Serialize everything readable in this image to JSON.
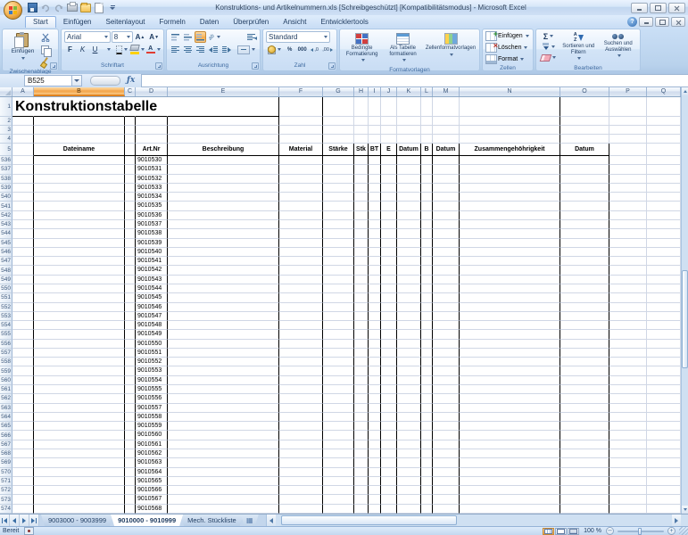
{
  "window": {
    "title": "Konstruktions- und Artikelnummern.xls [Schreibgeschützt] [Kompatibilitätsmodus] - Microsoft Excel",
    "help": "?"
  },
  "ribbon": {
    "tabs": [
      {
        "label": "Start",
        "active": true
      },
      {
        "label": "Einfügen",
        "active": false
      },
      {
        "label": "Seitenlayout",
        "active": false
      },
      {
        "label": "Formeln",
        "active": false
      },
      {
        "label": "Daten",
        "active": false
      },
      {
        "label": "Überprüfen",
        "active": false
      },
      {
        "label": "Ansicht",
        "active": false
      },
      {
        "label": "Entwicklertools",
        "active": false
      }
    ],
    "clipboard": {
      "group_label": "Zwischenablage",
      "paste_label": "Einfügen"
    },
    "font": {
      "group_label": "Schriftart",
      "font_name": "Arial",
      "font_size": "8",
      "bold": "F",
      "italic": "K",
      "underline": "U"
    },
    "alignment": {
      "group_label": "Ausrichtung",
      "orient": "ab"
    },
    "number": {
      "group_label": "Zahl",
      "format": "Standard",
      "percent": "%",
      "thousands": "000",
      "dec_inc": ",0",
      "dec_dec": ",00"
    },
    "styles": {
      "group_label": "Formatvorlagen",
      "conditional": "Bedingte Formatierung",
      "as_table": "Als Tabelle formatieren",
      "cell_styles": "Zellenformatvorlagen"
    },
    "cells": {
      "group_label": "Zellen",
      "insert": "Einfügen",
      "delete": "Löschen",
      "format": "Format"
    },
    "editing": {
      "group_label": "Bearbeiten",
      "autosum": "Σ",
      "sort": "Sortieren und Filtern",
      "find": "Suchen und Auswählen"
    }
  },
  "formula_bar": {
    "name_box": "B525",
    "fx": "ƒx",
    "formula": ""
  },
  "sheet": {
    "columns": [
      "A",
      "B",
      "C",
      "D",
      "E",
      "F",
      "G",
      "H",
      "I",
      "J",
      "K",
      "L",
      "M",
      "N",
      "O",
      "P",
      "Q"
    ],
    "selected_column": "B",
    "title_row": {
      "number": "1",
      "text": "Konstruktionstabelle"
    },
    "empty_rows": [
      "2",
      "3",
      "4"
    ],
    "header_row": {
      "number": "5",
      "cells": {
        "B": "Dateiname",
        "D": "Art.Nr",
        "E": "Beschreibung",
        "F": "Material",
        "G": "Stärke",
        "H": "Stk",
        "I": "BT",
        "J": "E",
        "K": "Datum",
        "L": "B",
        "M": "Datum",
        "N": "Zusammengehöhrigkeit",
        "O": "Datum"
      }
    },
    "data_rows": [
      {
        "row": "536",
        "art_nr": "9010530"
      },
      {
        "row": "537",
        "art_nr": "9010531"
      },
      {
        "row": "538",
        "art_nr": "9010532"
      },
      {
        "row": "539",
        "art_nr": "9010533"
      },
      {
        "row": "540",
        "art_nr": "9010534"
      },
      {
        "row": "541",
        "art_nr": "9010535"
      },
      {
        "row": "542",
        "art_nr": "9010536"
      },
      {
        "row": "543",
        "art_nr": "9010537"
      },
      {
        "row": "544",
        "art_nr": "9010538"
      },
      {
        "row": "545",
        "art_nr": "9010539"
      },
      {
        "row": "546",
        "art_nr": "9010540"
      },
      {
        "row": "547",
        "art_nr": "9010541"
      },
      {
        "row": "548",
        "art_nr": "9010542"
      },
      {
        "row": "549",
        "art_nr": "9010543"
      },
      {
        "row": "550",
        "art_nr": "9010544"
      },
      {
        "row": "551",
        "art_nr": "9010545"
      },
      {
        "row": "552",
        "art_nr": "9010546"
      },
      {
        "row": "553",
        "art_nr": "9010547"
      },
      {
        "row": "554",
        "art_nr": "9010548"
      },
      {
        "row": "555",
        "art_nr": "9010549"
      },
      {
        "row": "556",
        "art_nr": "9010550"
      },
      {
        "row": "557",
        "art_nr": "9010551"
      },
      {
        "row": "558",
        "art_nr": "9010552"
      },
      {
        "row": "559",
        "art_nr": "9010553"
      },
      {
        "row": "560",
        "art_nr": "9010554"
      },
      {
        "row": "561",
        "art_nr": "9010555"
      },
      {
        "row": "562",
        "art_nr": "9010556"
      },
      {
        "row": "563",
        "art_nr": "9010557"
      },
      {
        "row": "564",
        "art_nr": "9010558"
      },
      {
        "row": "565",
        "art_nr": "9010559"
      },
      {
        "row": "566",
        "art_nr": "9010560"
      },
      {
        "row": "567",
        "art_nr": "9010561"
      },
      {
        "row": "568",
        "art_nr": "9010562"
      },
      {
        "row": "569",
        "art_nr": "9010563"
      },
      {
        "row": "570",
        "art_nr": "9010564"
      },
      {
        "row": "571",
        "art_nr": "9010565"
      },
      {
        "row": "572",
        "art_nr": "9010566"
      },
      {
        "row": "573",
        "art_nr": "9010567"
      },
      {
        "row": "574",
        "art_nr": "9010568"
      }
    ]
  },
  "sheet_tabs": {
    "tabs": [
      {
        "label": "9003000 - 9003999",
        "active": false
      },
      {
        "label": "9010000 - 9010999",
        "active": true
      },
      {
        "label": "Mech. Stückliste",
        "active": false
      }
    ]
  },
  "status_bar": {
    "ready": "Bereit",
    "zoom_level": "100 %",
    "zoom_out": "−",
    "zoom_in": "+"
  },
  "colors": {
    "selection_orange": "#F6AE5A",
    "table_border": "#000000",
    "gridline": "#D0D7E5",
    "titlebar_blue": "#CFE0F5",
    "ribbon_blue": "#C9DDF4"
  }
}
